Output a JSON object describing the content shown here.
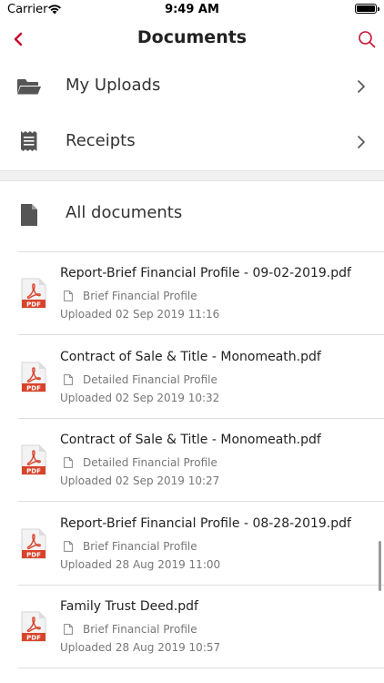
{
  "status_bar": {
    "carrier": "Carrier",
    "time": "9:49 AM"
  },
  "nav": {
    "title": "Documents",
    "back_icon": "chevron-left-icon",
    "search_icon": "search-icon",
    "accent_color": "#c8102e"
  },
  "menu": [
    {
      "label": "My Uploads",
      "icon": "folder-open-icon"
    },
    {
      "label": "Receipts",
      "icon": "receipt-icon"
    }
  ],
  "all_documents": {
    "label": "All documents",
    "icon": "document-icon"
  },
  "documents": [
    {
      "title": "Report-Brief Financial Profile - 09-02-2019.pdf",
      "type": "Brief Financial Profile",
      "uploaded": "Uploaded 02 Sep 2019 11:16"
    },
    {
      "title": "Contract of Sale & Title - Monomeath.pdf",
      "type": "Detailed Financial Profile",
      "uploaded": "Uploaded 02 Sep 2019 10:32"
    },
    {
      "title": "Contract of Sale & Title - Monomeath.pdf",
      "type": "Detailed Financial Profile",
      "uploaded": "Uploaded 02 Sep 2019 10:27"
    },
    {
      "title": "Report-Brief Financial Profile - 08-28-2019.pdf",
      "type": "Brief Financial Profile",
      "uploaded": "Uploaded 28 Aug 2019 11:00"
    },
    {
      "title": "Family Trust Deed.pdf",
      "type": "Brief Financial Profile",
      "uploaded": "Uploaded 28 Aug 2019 10:57"
    }
  ],
  "pdf_badge": "PDF"
}
